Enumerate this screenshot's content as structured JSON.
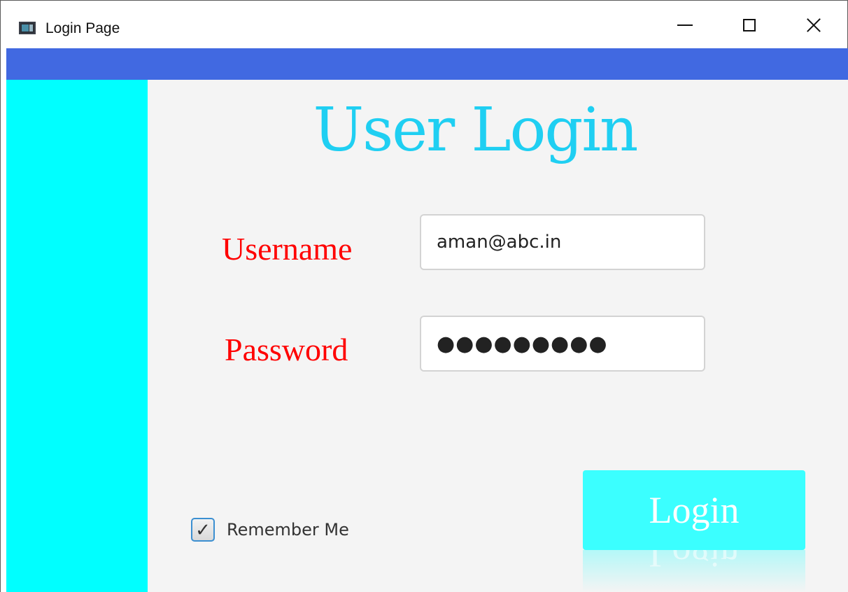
{
  "window": {
    "title": "Login Page",
    "app_icon": "window-app-icon",
    "controls": {
      "minimize": "minimize-icon",
      "maximize": "maximize-icon",
      "close": "close-icon"
    }
  },
  "colors": {
    "top_bar": "#4169e1",
    "left_bar": "#00ffff",
    "heading": "#1fcff2",
    "label": "#ff0000",
    "login_button": "#3bffff"
  },
  "form": {
    "heading": "User Login",
    "username_label": "Username",
    "username_value": "aman@abc.in",
    "password_label": "Password",
    "password_value": "●●●●●●●●●",
    "remember_me_label": "Remember Me",
    "remember_me_checked": true,
    "checkbox_mark": "✓",
    "login_button_label": "Login"
  }
}
